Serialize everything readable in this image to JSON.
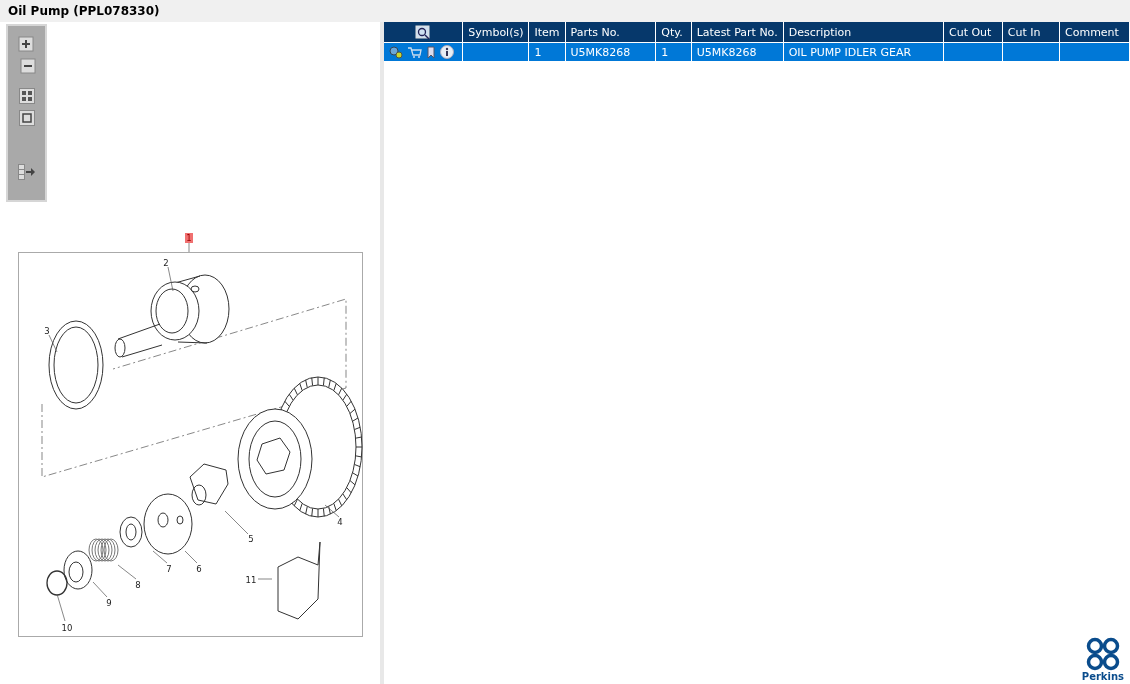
{
  "window": {
    "title": "Oil Pump (PPL078330)"
  },
  "toolbar": {
    "buttons": [
      {
        "kind": "zoom-in"
      },
      {
        "kind": "zoom-out"
      },
      {
        "kind": "fit"
      },
      {
        "kind": "actual"
      },
      {
        "kind": "export"
      }
    ]
  },
  "illustration": {
    "callouts": [
      {
        "label": "1",
        "selected": true
      },
      {
        "label": "2",
        "selected": false
      },
      {
        "label": "3",
        "selected": false
      },
      {
        "label": "4",
        "selected": false
      },
      {
        "label": "5",
        "selected": false
      },
      {
        "label": "6",
        "selected": false
      },
      {
        "label": "7",
        "selected": false
      },
      {
        "label": "8",
        "selected": false
      },
      {
        "label": "9",
        "selected": false
      },
      {
        "label": "10",
        "selected": false
      },
      {
        "label": "11",
        "selected": false
      }
    ]
  },
  "table": {
    "columns": [
      "Symbol(s)",
      "Item",
      "Parts No.",
      "Qty.",
      "Latest Part No.",
      "Description",
      "Cut Out",
      "Cut In",
      "Comment"
    ],
    "rows": [
      {
        "selected": true,
        "cells": [
          "",
          "1",
          "U5MK8268",
          "1",
          "U5MK8268",
          "OIL PUMP IDLER GEAR",
          "",
          "",
          ""
        ]
      }
    ]
  },
  "logo": {
    "text": "Perkins"
  }
}
